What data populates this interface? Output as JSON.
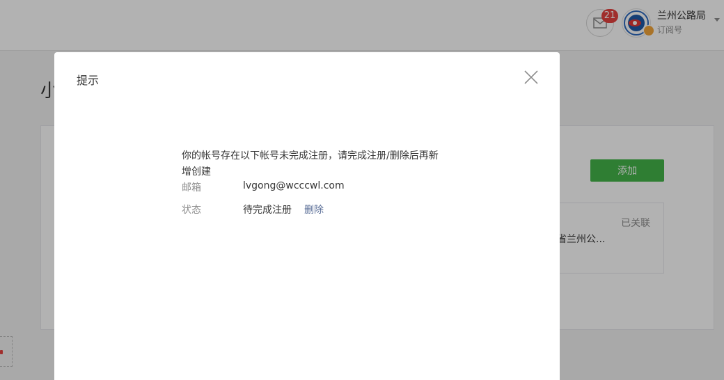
{
  "header": {
    "unread_count": "21",
    "account_name": "兰州公路局",
    "account_type": "订阅号"
  },
  "page": {
    "title_fragment": "小",
    "add_button": "添加",
    "linked_item": {
      "status": "已关联",
      "name": "省兰州公..."
    }
  },
  "dialog": {
    "title": "提示",
    "message": "你的帐号存在以下帐号未完成注册，请完成注册/删除后再新增创建",
    "email_label": "邮箱",
    "email_value": "lvgong@wcccwl.com",
    "status_label": "状态",
    "status_value": "待完成注册",
    "delete_link": "删除"
  },
  "colors": {
    "primary_green": "#44b549",
    "badge_red": "#e64340",
    "link_blue": "#576b95"
  },
  "icons": {
    "message": "mail-icon",
    "close": "close-icon",
    "verified": "verified-icon",
    "dropdown": "caret-down-icon"
  }
}
